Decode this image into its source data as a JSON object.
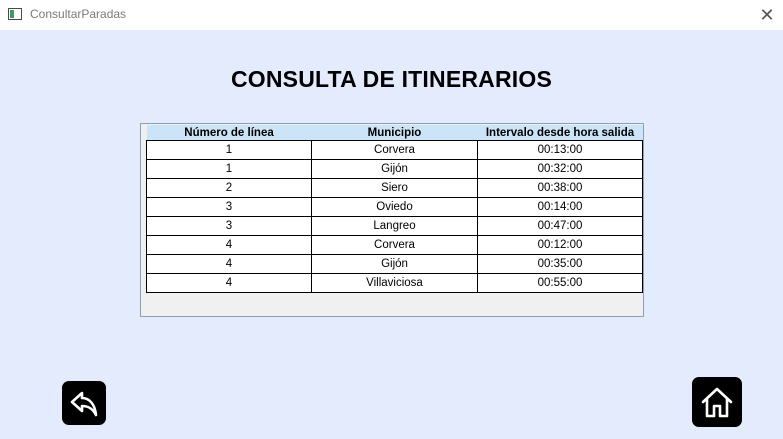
{
  "window": {
    "title": "ConsultarParadas"
  },
  "page": {
    "heading": "CONSULTA DE ITINERARIOS"
  },
  "table": {
    "columns": [
      "Número de línea",
      "Municipio",
      "Intervalo desde hora salida"
    ],
    "rows": [
      [
        "1",
        "Corvera",
        "00:13:00"
      ],
      [
        "1",
        "Gijón",
        "00:32:00"
      ],
      [
        "2",
        "Siero",
        "00:38:00"
      ],
      [
        "3",
        "Oviedo",
        "00:14:00"
      ],
      [
        "3",
        "Langreo",
        "00:47:00"
      ],
      [
        "4",
        "Corvera",
        "00:12:00"
      ],
      [
        "4",
        "Gijón",
        "00:35:00"
      ],
      [
        "4",
        "Villaviciosa",
        "00:55:00"
      ]
    ]
  },
  "icons": {
    "app": "app-window-icon",
    "close": "close-icon",
    "back": "back-arrow-icon",
    "home": "home-icon"
  },
  "colors": {
    "background": "#e3ebfd",
    "header_row": "#cce4f7",
    "nav_button": "#000000"
  }
}
